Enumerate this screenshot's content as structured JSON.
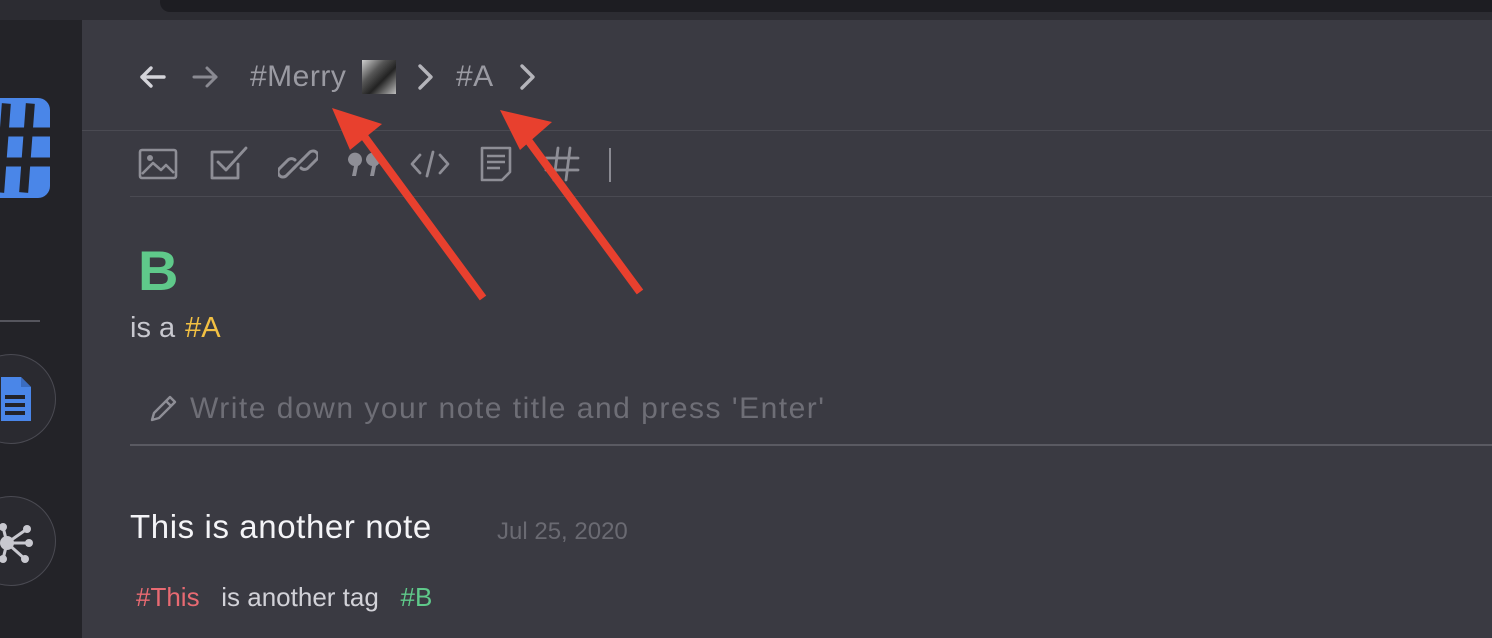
{
  "nav": {
    "back_icon": "arrow-left-icon",
    "forward_icon": "arrow-right-icon",
    "breadcrumb": [
      "#Merry",
      "#A"
    ],
    "separator_icon": "chevron-right-icon"
  },
  "toolbar": {
    "icons": [
      "image-icon",
      "checkbox-icon",
      "link-icon",
      "quote-icon",
      "code-icon",
      "document-icon",
      "hashtag-icon"
    ]
  },
  "sidebar": {
    "logo_icon": "hashtag-logo-icon",
    "items": [
      {
        "icon": "document-icon"
      },
      {
        "icon": "graph-icon"
      }
    ]
  },
  "note": {
    "title": "B",
    "body_prefix": "is a",
    "body_tag": "#A"
  },
  "input": {
    "placeholder": "Write down your note title and press 'Enter'"
  },
  "other_note": {
    "title": "This is another note",
    "date": "Jul 25, 2020",
    "tag1": "#This",
    "text": "is another tag",
    "tag2": "#B"
  },
  "colors": {
    "background": "#3a3a42",
    "sidebar": "#232328",
    "accent_blue": "#4a86e8",
    "tag_green": "#5fc98a",
    "tag_yellow": "#f2c043",
    "tag_red": "#e86a72",
    "annotation_arrow": "#e8402e"
  }
}
